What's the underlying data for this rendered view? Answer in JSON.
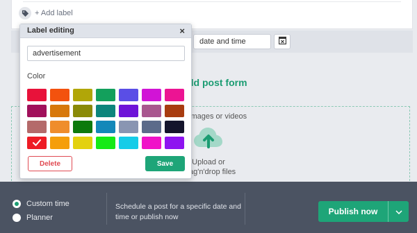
{
  "top": {
    "add_label": "+ Add label",
    "tag_icon": "tag-icon"
  },
  "date": {
    "value": "date and time",
    "calendar_icon": "calendar-x-icon"
  },
  "page_title": "dd post form",
  "dropzone": {
    "label": "images or videos",
    "upload_line1": "Upload or",
    "upload_line2": "ag'n'drop files",
    "icon": "cloud-upload-icon"
  },
  "bottom": {
    "custom_time": "Custom time",
    "planner": "Planner",
    "schedule_text": "Schedule a post for a specific date and time or publish now",
    "publish_label": "Publish now",
    "accent": "#1ea578"
  },
  "popup": {
    "title": "Label editing",
    "close": "×",
    "input_value": "advertisement",
    "color_label": "Color",
    "delete_label": "Delete",
    "save_label": "Save",
    "selected_color": "#ee1c25",
    "colors": [
      "#e8123a",
      "#f3520e",
      "#b1a608",
      "#13a05c",
      "#5a4ee6",
      "#d114d6",
      "#ec1493",
      "#a1105b",
      "#d7780c",
      "#8a8a08",
      "#0d857c",
      "#6e14d8",
      "#a9578f",
      "#a83c10",
      "#b46a6a",
      "#ef8d2c",
      "#0d7a0d",
      "#1388b9",
      "#8995b2",
      "#5c6b8a",
      "#14152c",
      "#ee1c25",
      "#f59e0b",
      "#e3d10e",
      "#16ea16",
      "#15cce8",
      "#f012c8",
      "#8e14f0"
    ]
  }
}
